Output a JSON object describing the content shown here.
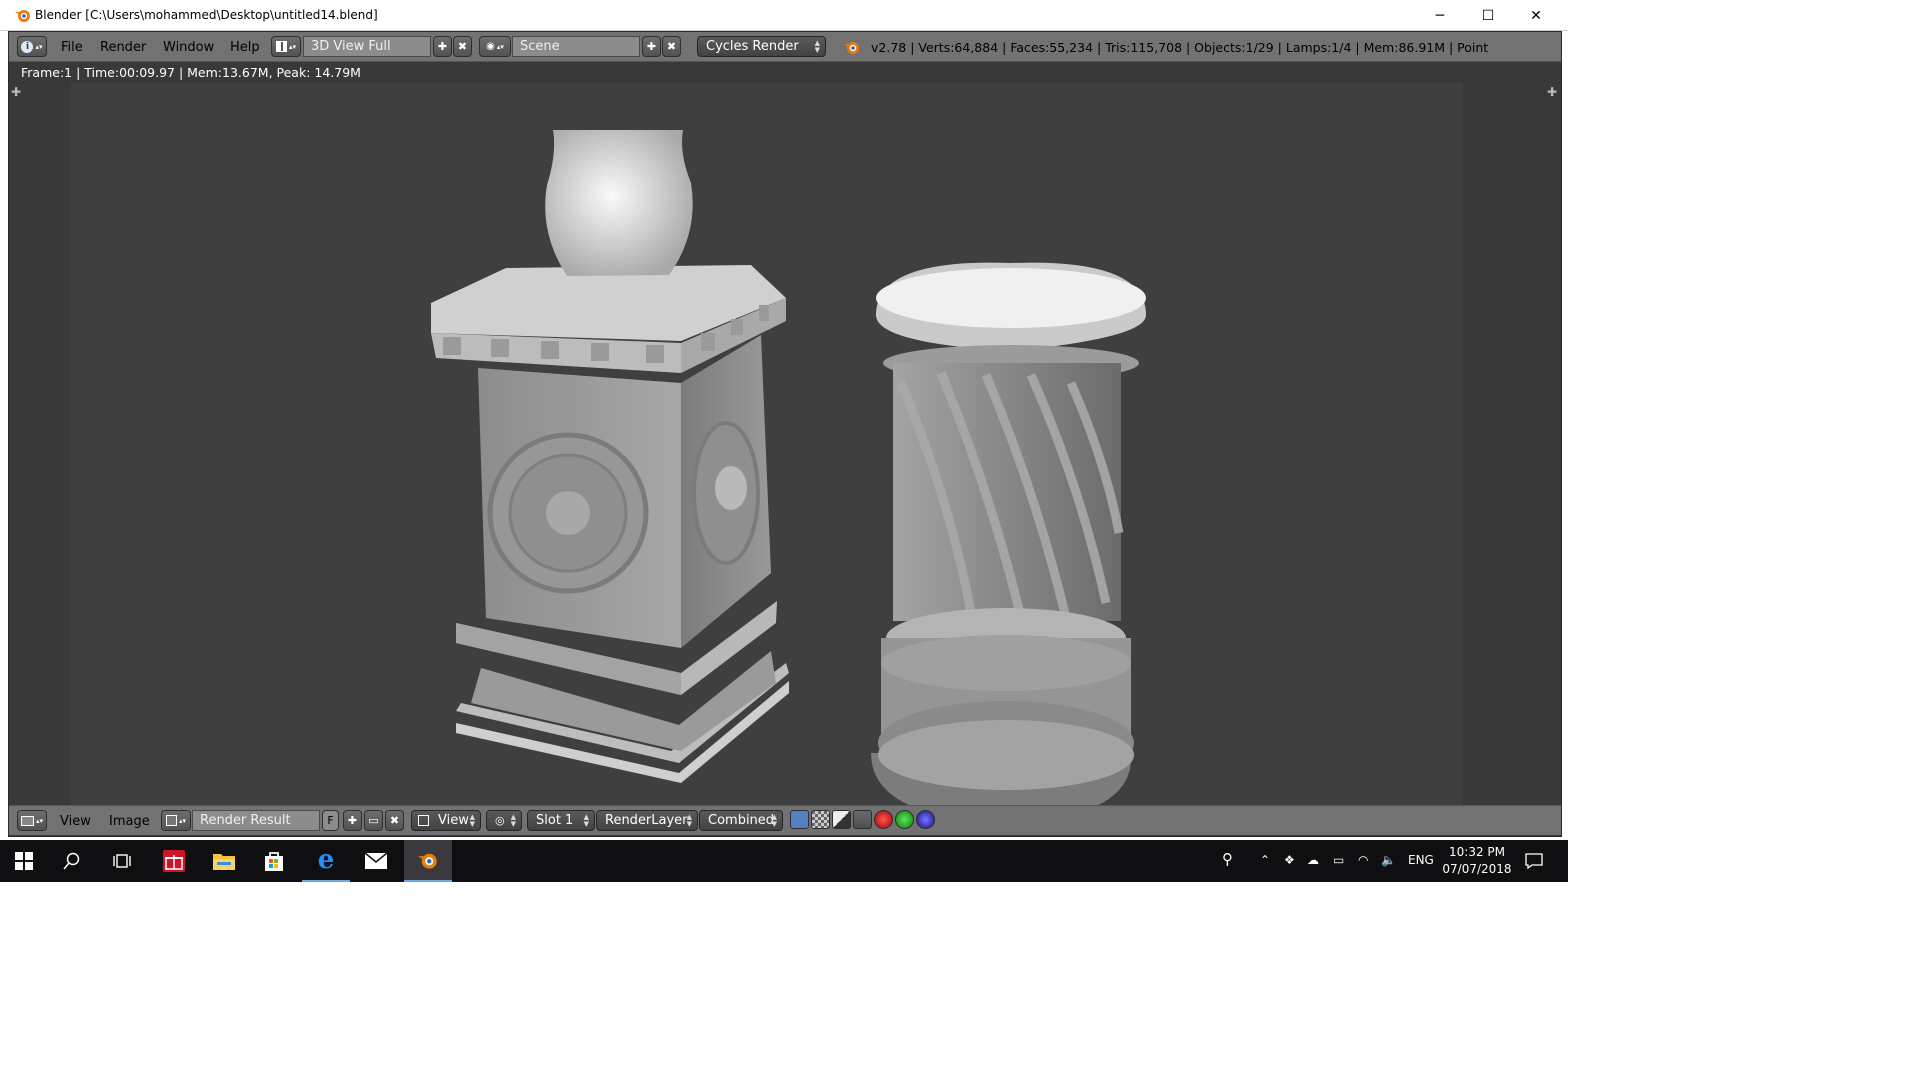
{
  "window": {
    "title": "Blender [C:\\Users\\mohammed\\Desktop\\untitled14.blend]",
    "minimize": "─",
    "maximize": "☐",
    "close": "✕"
  },
  "info_header": {
    "menus": [
      "File",
      "Render",
      "Window",
      "Help"
    ],
    "screen_layout": "3D View Full",
    "scene": "Scene",
    "render_engine": "Cycles Render",
    "stats": "v2.78 | Verts:64,884 | Faces:55,234 | Tris:115,708 | Objects:1/29 | Lamps:1/4 | Mem:86.91M | Point"
  },
  "image_editor": {
    "render_info": "Frame:1 | Time:00:09.97 | Mem:13.67M, Peak: 14.79M"
  },
  "bottom_header": {
    "view_menu": "View",
    "image_menu": "Image",
    "image_name": "Render Result",
    "fake_user": "F",
    "view_select": "View",
    "slot": "Slot 1",
    "render_layer": "RenderLayer",
    "pass": "Combined"
  },
  "taskbar": {
    "language": "ENG",
    "time": "10:32 PM",
    "date": "07/07/2018"
  },
  "colors": {
    "blender_orange": "#e87d0d",
    "header_gray": "#727272",
    "editor_bg": "#393939",
    "taskbar_bg": "#0f0f12",
    "edge_blue": "#1e7fd6"
  }
}
